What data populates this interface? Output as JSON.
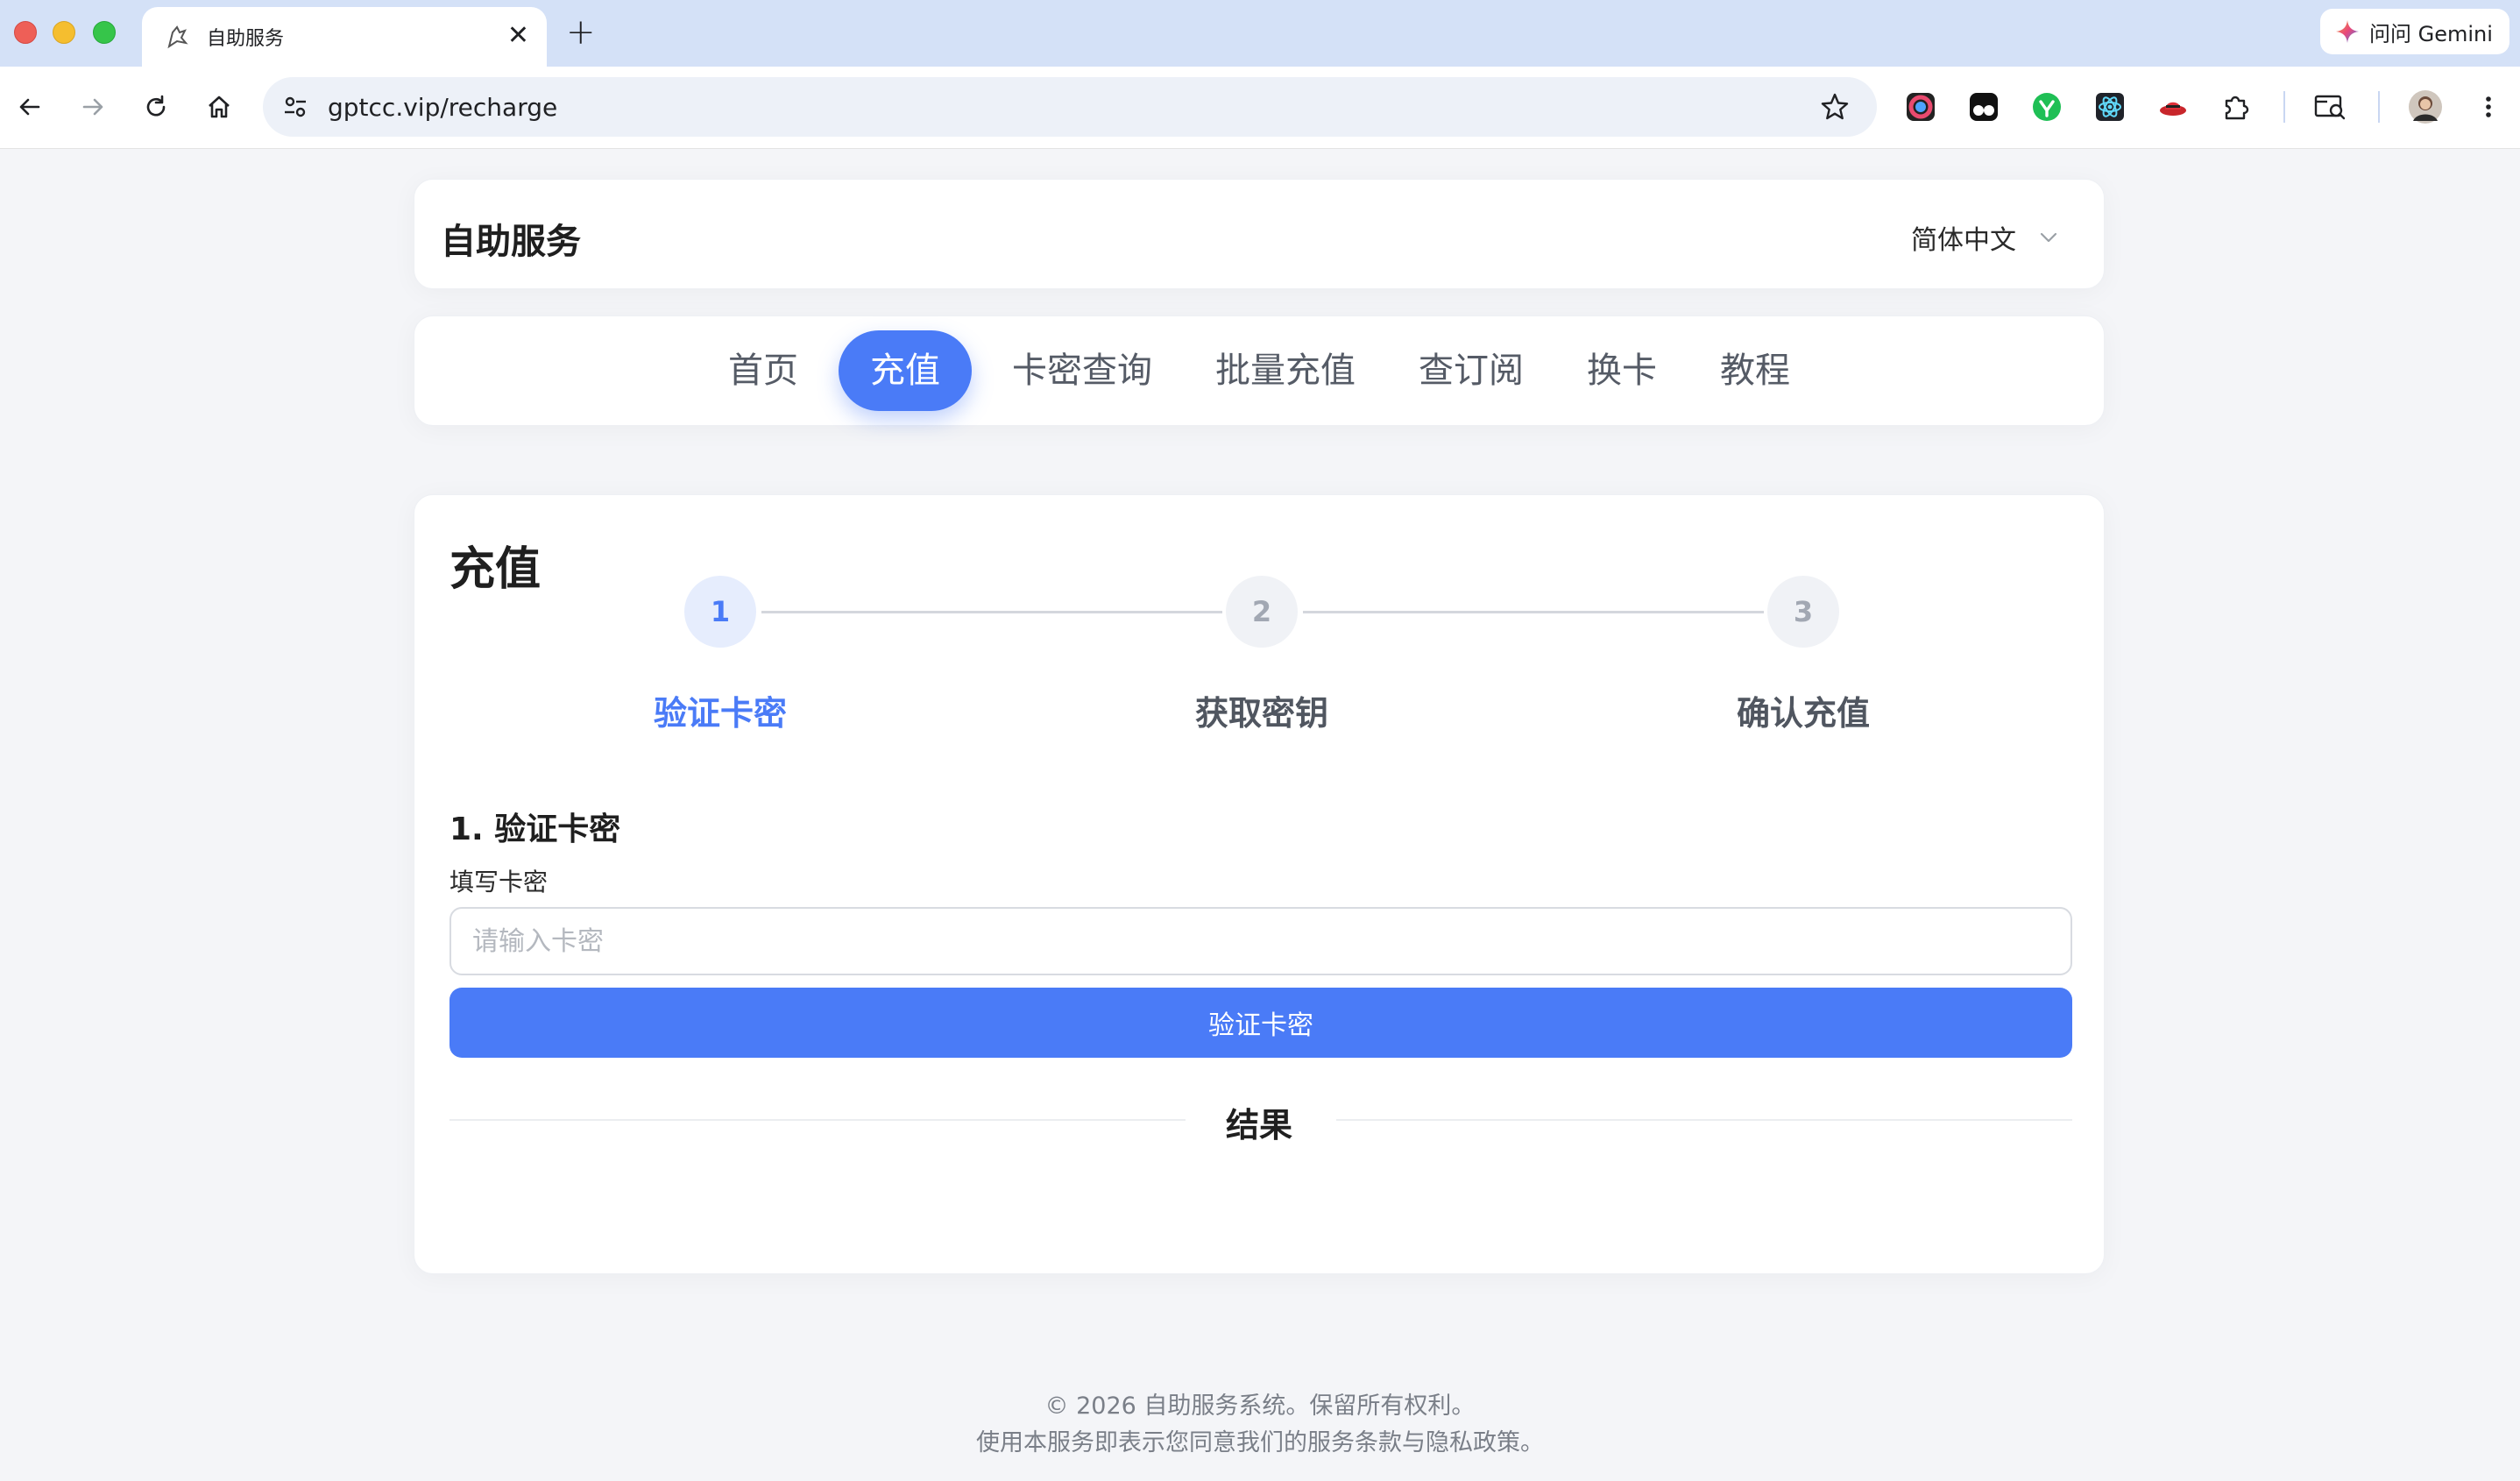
{
  "browser": {
    "tab_title": "自助服务",
    "url": "gptcc.vip/recharge",
    "gemini_label": "问问 Gemini",
    "icons": [
      "back-icon",
      "forward-icon",
      "reload-icon",
      "home-icon",
      "site-info-icon",
      "bookmark-star-icon",
      "extensions-icon",
      "tab-search-icon",
      "profile-avatar",
      "more-menu-icon"
    ]
  },
  "header": {
    "title": "自助服务",
    "language": "简体中文"
  },
  "nav": {
    "items": [
      {
        "label": "首页",
        "active": false
      },
      {
        "label": "充值",
        "active": true
      },
      {
        "label": "卡密查询",
        "active": false
      },
      {
        "label": "批量充值",
        "active": false
      },
      {
        "label": "查订阅",
        "active": false
      },
      {
        "label": "换卡",
        "active": false
      },
      {
        "label": "教程",
        "active": false
      }
    ]
  },
  "main": {
    "title": "充值",
    "steps": [
      {
        "number": "1",
        "label": "验证卡密",
        "active": true
      },
      {
        "number": "2",
        "label": "获取密钥",
        "active": false
      },
      {
        "number": "3",
        "label": "确认充值",
        "active": false
      }
    ],
    "section_title": "1. 验证卡密",
    "field_label": "填写卡密",
    "input_placeholder": "请输入卡密",
    "input_value": "",
    "verify_button": "验证卡密",
    "result_label": "结果"
  },
  "footer": {
    "copyright": "© 2026 自助服务系统。保留所有权利。",
    "terms": "使用本服务即表示您同意我们的服务条款与隐私政策。"
  },
  "colors": {
    "accent": "#4a7bf7",
    "step_active_bg": "#e6edfd",
    "page_bg": "#f4f5f8"
  }
}
